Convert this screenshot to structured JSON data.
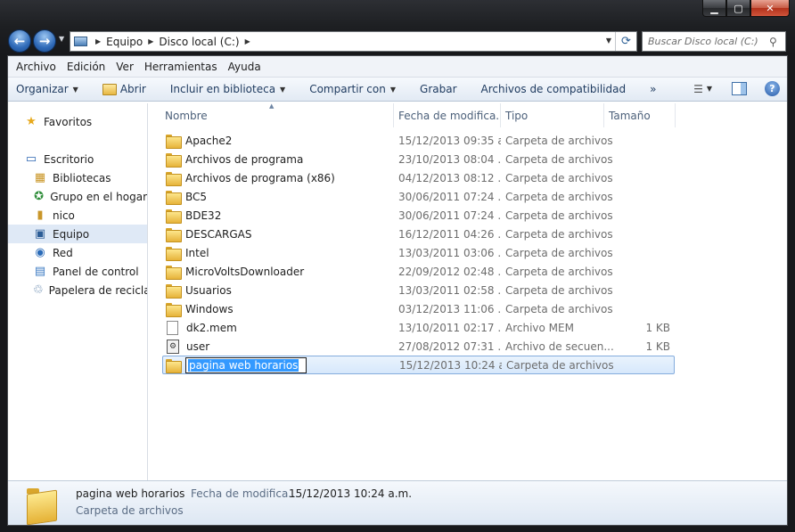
{
  "window": {
    "caption": {
      "minimize": "▁",
      "maximize": "▢",
      "close": "✕"
    }
  },
  "nav": {
    "back_icon": "←",
    "forward_icon": "→",
    "breadcrumb": [
      "Equipo",
      "Disco local (C:)"
    ],
    "search_placeholder": "Buscar Disco local (C:)"
  },
  "menu": [
    "Archivo",
    "Edición",
    "Ver",
    "Herramientas",
    "Ayuda"
  ],
  "toolbar": {
    "organize": "Organizar",
    "open": "Abrir",
    "include_library": "Incluir en biblioteca",
    "share": "Compartir con",
    "burn": "Grabar",
    "compat_files": "Archivos de compatibilidad",
    "more": "»"
  },
  "sidebar": {
    "items": [
      {
        "label": "Favoritos",
        "icon": "star-icon"
      },
      {
        "label": "Escritorio",
        "icon": "desktop-icon"
      },
      {
        "label": "Bibliotecas",
        "icon": "libraries-icon"
      },
      {
        "label": "Grupo en el hogar",
        "icon": "homegroup-icon"
      },
      {
        "label": "nico",
        "icon": "user-icon"
      },
      {
        "label": "Equipo",
        "icon": "computer-icon",
        "selected": true
      },
      {
        "label": "Red",
        "icon": "network-icon"
      },
      {
        "label": "Panel de control",
        "icon": "control-panel-icon"
      },
      {
        "label": "Papelera de reciclaje",
        "icon": "recycle-bin-icon"
      }
    ]
  },
  "columns": {
    "name": "Nombre",
    "date": "Fecha de modifica...",
    "type": "Tipo",
    "size": "Tamaño"
  },
  "files": [
    {
      "name": "Apache2",
      "date": "15/12/2013 09:35 a...",
      "type": "Carpeta de archivos",
      "size": "",
      "icon": "folder-icon"
    },
    {
      "name": "Archivos de programa",
      "date": "23/10/2013 08:04 ...",
      "type": "Carpeta de archivos",
      "size": "",
      "icon": "folder-icon"
    },
    {
      "name": "Archivos de programa (x86)",
      "date": "04/12/2013 08:12 ...",
      "type": "Carpeta de archivos",
      "size": "",
      "icon": "folder-icon"
    },
    {
      "name": "BC5",
      "date": "30/06/2011 07:24 ...",
      "type": "Carpeta de archivos",
      "size": "",
      "icon": "folder-icon"
    },
    {
      "name": "BDE32",
      "date": "30/06/2011 07:24 ...",
      "type": "Carpeta de archivos",
      "size": "",
      "icon": "folder-icon"
    },
    {
      "name": "DESCARGAS",
      "date": "16/12/2011 04:26 ...",
      "type": "Carpeta de archivos",
      "size": "",
      "icon": "folder-icon"
    },
    {
      "name": "Intel",
      "date": "13/03/2011 03:06 ...",
      "type": "Carpeta de archivos",
      "size": "",
      "icon": "folder-icon"
    },
    {
      "name": "MicroVoltsDownloader",
      "date": "22/09/2012 02:48 ...",
      "type": "Carpeta de archivos",
      "size": "",
      "icon": "folder-icon"
    },
    {
      "name": "Usuarios",
      "date": "13/03/2011 02:58 ...",
      "type": "Carpeta de archivos",
      "size": "",
      "icon": "folder-icon"
    },
    {
      "name": "Windows",
      "date": "03/12/2013 11:06 ...",
      "type": "Carpeta de archivos",
      "size": "",
      "icon": "folder-icon"
    },
    {
      "name": "dk2.mem",
      "date": "13/10/2011 02:17 ...",
      "type": "Archivo MEM",
      "size": "1 KB",
      "icon": "file-icon"
    },
    {
      "name": "user",
      "date": "27/08/2012 07:31 ...",
      "type": "Archivo de secuen...",
      "size": "1 KB",
      "icon": "batch-file-icon"
    }
  ],
  "renaming": {
    "name": "pagina web horarios",
    "date": "15/12/2013 10:24 a...",
    "type": "Carpeta de archivos"
  },
  "details": {
    "name": "pagina web horarios",
    "date_label": "Fecha de modifica...",
    "date_value": "15/12/2013 10:24 a.m.",
    "type": "Carpeta de archivos"
  }
}
